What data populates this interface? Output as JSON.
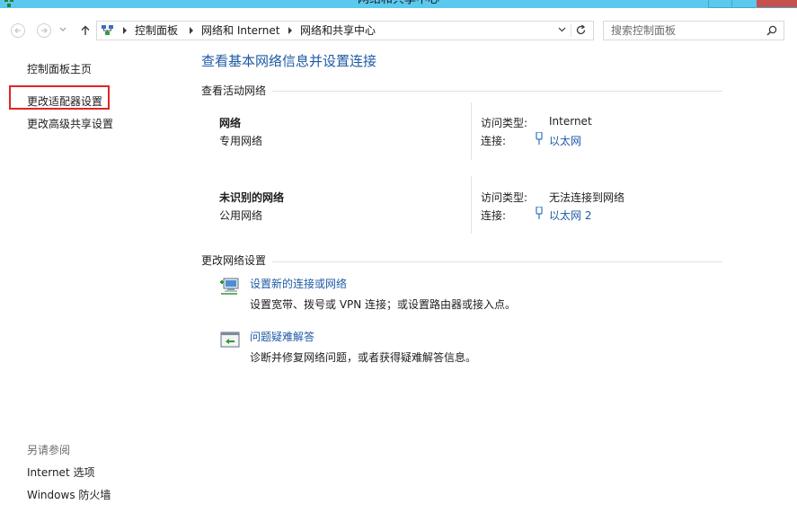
{
  "window": {
    "title": "网络和共享中心"
  },
  "address_bar": {
    "breadcrumbs": [
      "控制面板",
      "网络和 Internet",
      "网络和共享中心"
    ]
  },
  "search": {
    "placeholder": "搜索控制面板"
  },
  "sidebar": {
    "links": [
      {
        "label": "控制面板主页"
      },
      {
        "label": "更改适配器设置"
      },
      {
        "label": "更改高级共享设置"
      }
    ],
    "see_also_label": "另请参阅",
    "see_also_links": [
      {
        "label": "Internet 选项"
      },
      {
        "label": "Windows 防火墙"
      }
    ]
  },
  "main": {
    "title": "查看基本网络信息并设置连接",
    "active_networks_header": "查看活动网络",
    "access_type_label": "访问类型:",
    "connection_label": "连接:",
    "networks": [
      {
        "name": "网络",
        "type": "专用网络",
        "access_type": "Internet",
        "connection": "以太网"
      },
      {
        "name": "未识别的网络",
        "type": "公用网络",
        "access_type": "无法连接到网络",
        "connection": "以太网 2"
      }
    ],
    "change_settings_header": "更改网络设置",
    "tasks": [
      {
        "title": "设置新的连接或网络",
        "description": "设置宽带、拨号或 VPN 连接；或设置路由器或接入点。"
      },
      {
        "title": "问题疑难解答",
        "description": "诊断并修复网络问题，或者获得疑难解答信息。"
      }
    ]
  },
  "colors": {
    "titlebar": "#5bc8ee",
    "link": "#1e5aa5",
    "highlight_box": "#e02424",
    "close_button": "#c7514f"
  }
}
